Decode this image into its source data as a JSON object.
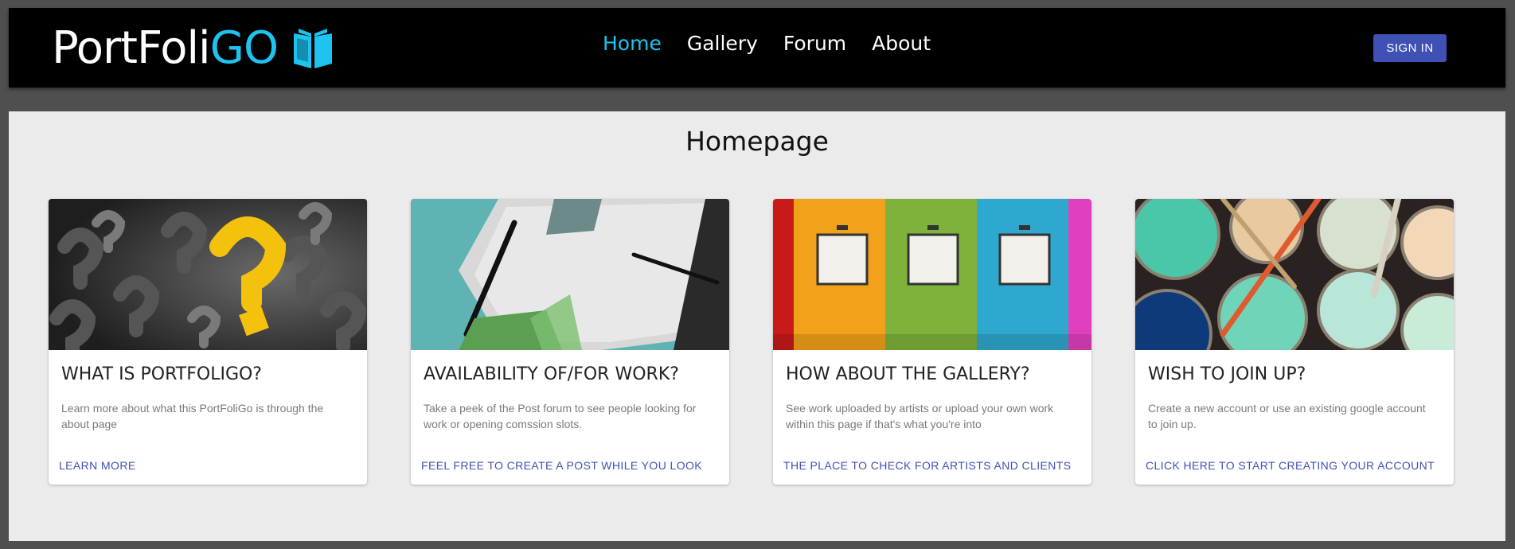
{
  "header": {
    "logo_part1": "PortFoli",
    "logo_part2": "GO",
    "nav": [
      {
        "label": "Home",
        "active": true
      },
      {
        "label": "Gallery",
        "active": false
      },
      {
        "label": "Forum",
        "active": false
      },
      {
        "label": "About",
        "active": false
      }
    ],
    "signin_label": "SIGN IN"
  },
  "page": {
    "title": "Homepage"
  },
  "cards": [
    {
      "title": "WHAT IS PORTFOLIGO?",
      "text": "Learn more about what this PortFoliGo is through the about page",
      "action": "LEARN MORE"
    },
    {
      "title": "AVAILABILITY OF/FOR WORK?",
      "text": "Take a peek of the Post forum to see people looking for work or opening comssion slots.",
      "action": "FEEL FREE TO CREATE A POST WHILE YOU LOOK"
    },
    {
      "title": "HOW ABOUT THE GALLERY?",
      "text": "See work uploaded by artists or upload your own work within this page if that's what you're into",
      "action": "THE PLACE TO CHECK FOR ARTISTS AND CLIENTS"
    },
    {
      "title": "WISH TO JOIN UP?",
      "text": "Create a new account or use an existing google account to join up.",
      "action": "CLICK HERE TO START CREATING YOUR ACCOUNT"
    }
  ],
  "colors": {
    "accent": "#1ec3f0",
    "primary": "#3f51b5",
    "header_bg": "#000000",
    "page_bg": "#ebebeb"
  }
}
